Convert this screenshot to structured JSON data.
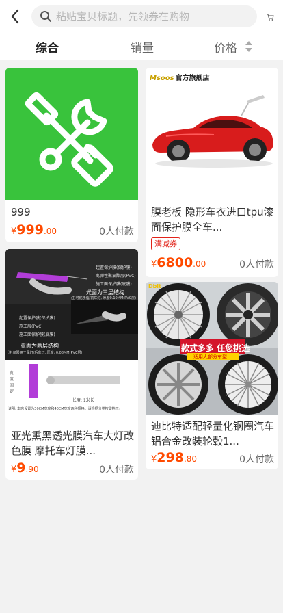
{
  "search": {
    "placeholder": "粘贴宝贝标题，先领券在购物"
  },
  "sort": {
    "tabs": [
      "综合",
      "销量",
      "价格"
    ]
  },
  "products": [
    {
      "title": "999",
      "price_currency": "¥",
      "price_int": "999",
      "price_dec": ".00",
      "sold": "0人付款"
    },
    {
      "store": "官方旗舰店",
      "store_logo": "Msoos",
      "title": "膜老板 隐形车衣进口tpu漆面保护膜全车...",
      "coupon": "满减券",
      "price_currency": "¥",
      "price_int": "6800",
      "price_dec": ".00",
      "sold": "0人付款"
    },
    {
      "title": "亚光熏黑透光膜汽车大灯改色膜 摩托车灯膜...",
      "price_currency": "¥",
      "price_int": "9",
      "price_dec": ".90",
      "sold": "0人付款",
      "img_labels": {
        "l1": "起置保护膜(保护膜)",
        "l2": "离弹性聚氯酯层(PVC)",
        "l3": "施工面保护膜(底膜)",
        "three_layer": "光面为三层结构",
        "three_sub": "注:可贴于脂/前车灯, 厚度0.10MM(PVC层)",
        "l4": "起置保护膜(保护膜)",
        "l5": "施工层(PVC)",
        "l6": "施工面保护膜(底膜)",
        "two_layer": "亚面为两层结构",
        "two_sub": "注:仅限用于尾灯/后车灯, 厚度: 0.08MM(PVC层)",
        "side": "宽度固定",
        "length": "长度: 1米长",
        "note": "说明: 本店设置为30CM宽度和40CM宽度两种规格。请根据分类按需拍下。"
      }
    },
    {
      "title": "迪比特适配轻量化钢圈汽车铝合金改装轮毂1...",
      "price_currency": "¥",
      "price_int": "298",
      "price_dec": ".80",
      "sold": "0人付款",
      "banner": "款式多多 任您挑选",
      "banner_sub": "适用大部分车型",
      "logo": "Dbit"
    }
  ]
}
